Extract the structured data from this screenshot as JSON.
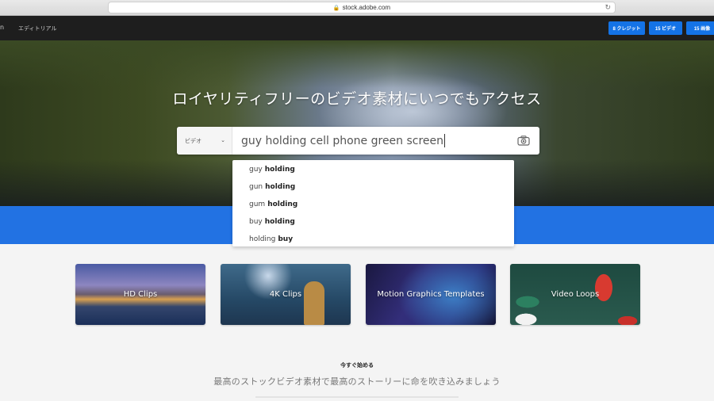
{
  "browser": {
    "url": "stock.adobe.com",
    "lock_icon": "lock-icon",
    "reload_icon": "reload-icon"
  },
  "topnav": {
    "left_fragment": "n",
    "editorial_link": "エディトリアル",
    "buttons": [
      {
        "label": "8 クレジット"
      },
      {
        "label": "15 ビデオ"
      },
      {
        "label": "15 画像"
      }
    ],
    "button_color": "#1473e6"
  },
  "hero": {
    "title": "ロイヤリティフリーのビデオ素材にいつでもアクセス"
  },
  "search": {
    "type_selected": "ビデオ",
    "query": "guy holding cell phone green screen",
    "camera_icon": "camera-icon"
  },
  "suggestions": [
    {
      "normal": "guy",
      "bold": "holding"
    },
    {
      "normal": "gun",
      "bold": "holding"
    },
    {
      "normal": "gum",
      "bold": "holding"
    },
    {
      "normal": "buy",
      "bold": "holding"
    },
    {
      "normal": "holding",
      "bold": "buy"
    }
  ],
  "categories": [
    {
      "label": "HD Clips"
    },
    {
      "label": "4K Clips"
    },
    {
      "label": "Motion Graphics Templates"
    },
    {
      "label": "Video Loops"
    }
  ],
  "footer": {
    "start_label": "今すぐ始める",
    "subtitle": "最高のストックビデオ素材で最高のストーリーに命を吹き込みましょう"
  },
  "colors": {
    "accent_blue": "#2272e3",
    "nav_bg": "#1e1e1e"
  }
}
